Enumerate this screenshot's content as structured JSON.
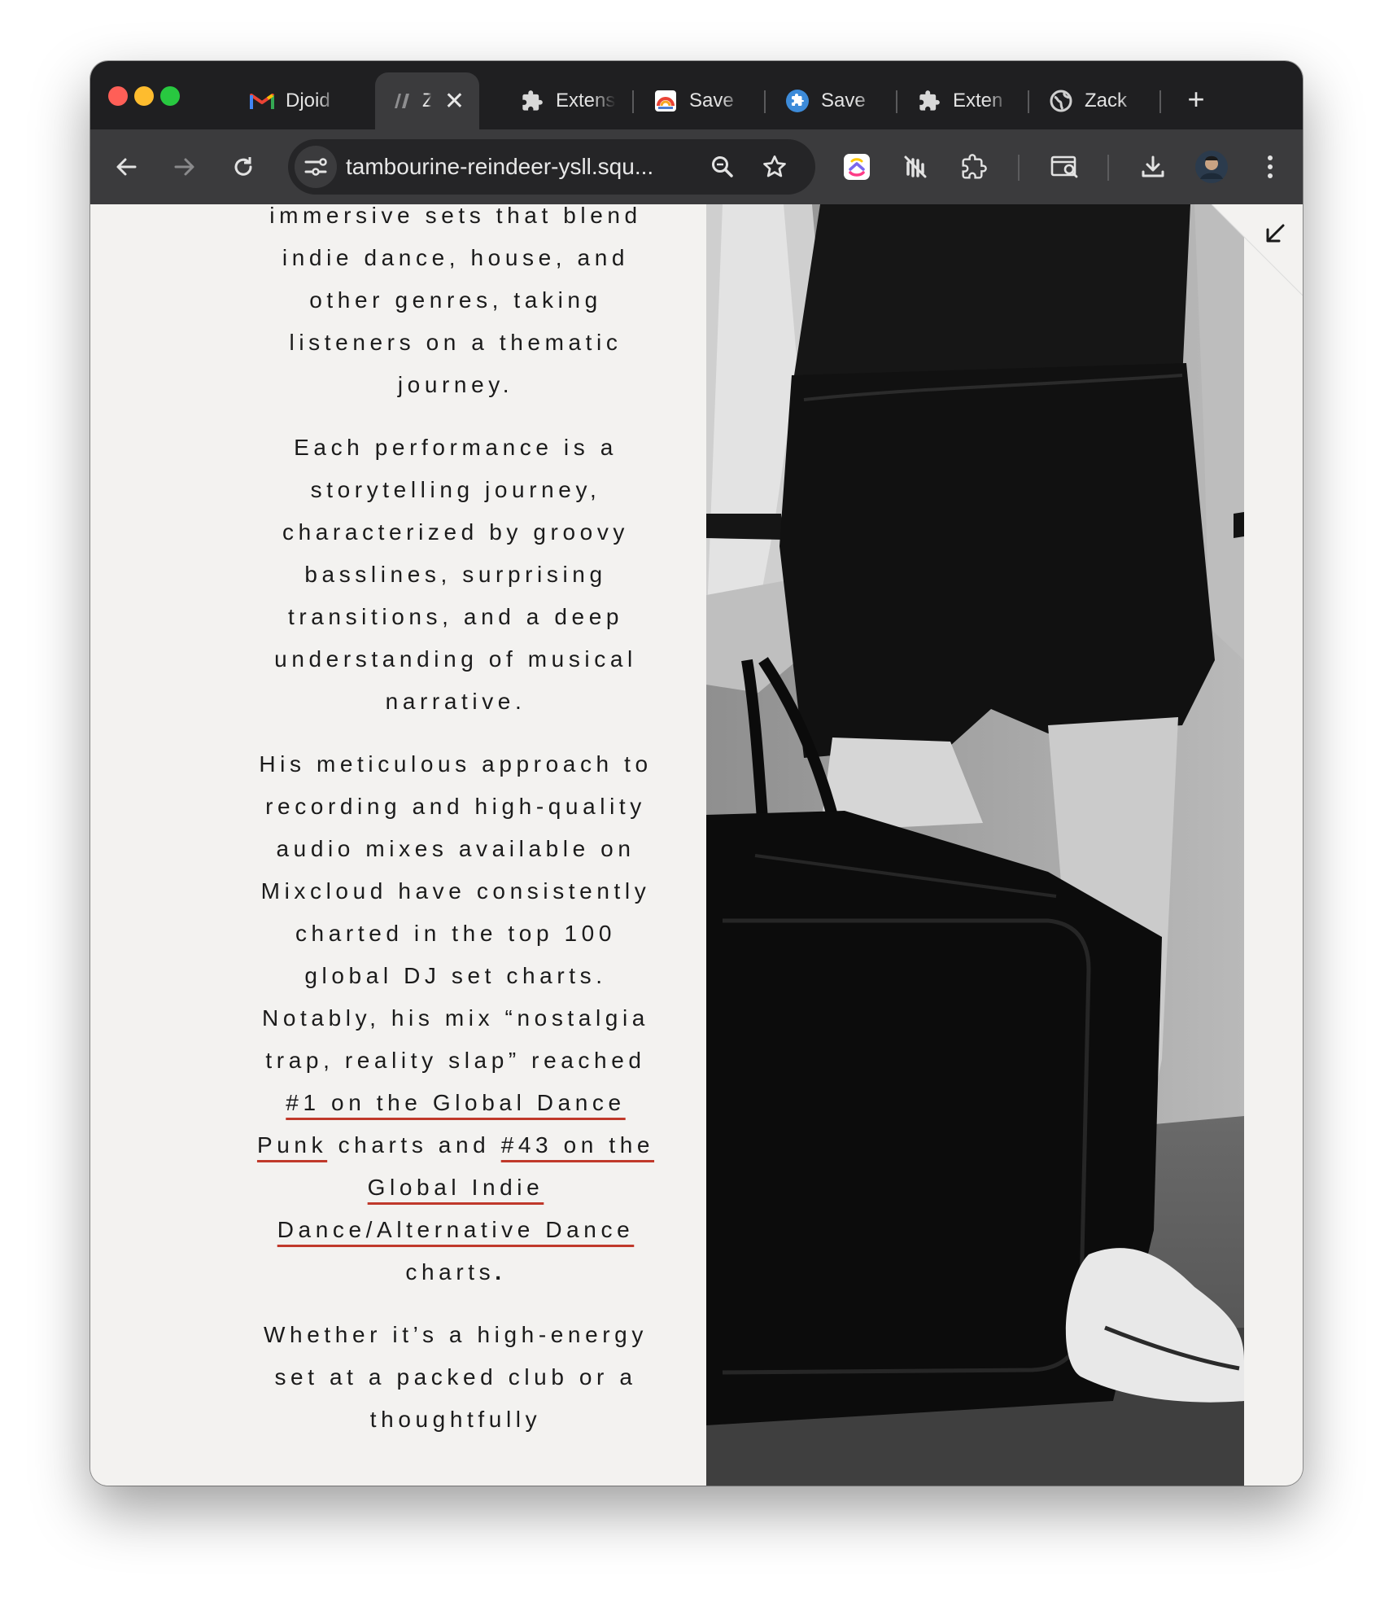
{
  "browser": {
    "tabs": [
      {
        "title": "Djoid",
        "icon": "gmail-icon"
      },
      {
        "title": "Za",
        "icon": "site-logo-icon",
        "active": true
      },
      {
        "title": "Extens",
        "icon": "puzzle-icon"
      },
      {
        "title": "Save",
        "icon": "save-app-icon"
      },
      {
        "title": "Save",
        "icon": "blue-extension-icon"
      },
      {
        "title": "Exten",
        "icon": "puzzle-icon"
      },
      {
        "title": "Zack",
        "icon": "globe-icon"
      }
    ],
    "new_tab_label": "+",
    "url": "tambourine-reindeer-ysll.squ..."
  },
  "content": {
    "para1": "immersive sets that blend indie dance, house, and other genres, taking listeners on a thematic journey.",
    "para2": "Each performance is a storytelling journey, characterized by groovy basslines, surprising transitions, and a deep understanding of musical narrative.",
    "para3_text1": "His meticulous approach to recording and high-quality audio mixes available on Mixcloud have consistently charted in the top 100 global DJ set charts. Notably, his mix “nostalgia trap, reality slap” reached ",
    "para3_link1": "#1 on the Global Dance Punk",
    "para3_text2": " charts and ",
    "para3_link2": "#43 on the Global Indie Dance/Alternative Dance",
    "para3_text3": " charts",
    "para3_end": ".",
    "para4": "Whether it’s a high-energy set at a packed club or a thoughtfully"
  },
  "colors": {
    "link_underline": "#c0392b",
    "page_bg": "#f3f2f0",
    "tab_strip": "#1f1f21",
    "toolbar": "#3b3b3d"
  }
}
